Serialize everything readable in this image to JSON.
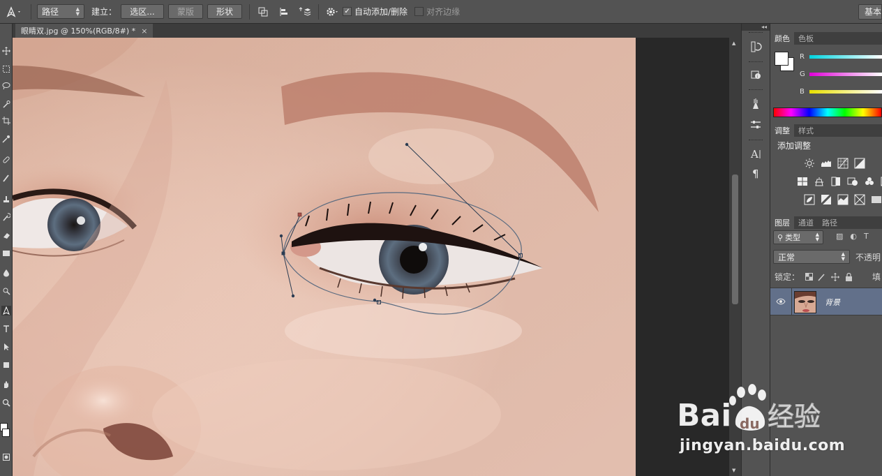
{
  "options_bar": {
    "tool_icon": "pen-icon",
    "mode_select": "路径",
    "make_label": "建立：",
    "selection_button": "选区...",
    "mask_button": "蒙版",
    "shape_button": "形状",
    "path_ops_icon": "path-operations-icon",
    "path_align_icon": "path-alignment-icon",
    "path_arrange_icon": "path-arrangement-icon",
    "settings_icon": "gear-icon",
    "auto_add_delete": {
      "label": "自动添加/删除",
      "checked": true
    },
    "align_edges": {
      "label": "对齐边缘",
      "checked": false
    },
    "workspace_button": "基本"
  },
  "document": {
    "tab_title": "眼睛双.jpg @ 150%(RGB/8#) *",
    "close_glyph": "×"
  },
  "toolbar": {
    "icons": [
      "move-icon",
      "marquee-icon",
      "lasso-icon",
      "quick-select-icon",
      "crop-icon",
      "eyedropper-icon",
      "healing-brush-icon",
      "brush-icon",
      "clone-stamp-icon",
      "history-brush-icon",
      "eraser-icon",
      "gradient-icon",
      "blur-icon",
      "dodge-icon",
      "pen-icon",
      "type-icon",
      "path-select-icon",
      "rectangle-icon",
      "hand-icon",
      "zoom-icon"
    ]
  },
  "icon_strip": {
    "icons": [
      "history-icon",
      "info-icon",
      "brush-presets-icon",
      "properties-icon",
      "character-icon",
      "paragraph-icon"
    ],
    "collapse_glyph": "◂◂"
  },
  "color_panel": {
    "tabs": [
      "颜色",
      "色板"
    ],
    "active_tab": 0,
    "channels": [
      {
        "label": "R",
        "color": "#00d4e0"
      },
      {
        "label": "G",
        "color": "#e000d8"
      },
      {
        "label": "B",
        "color": "#e8e000"
      }
    ]
  },
  "adjustments_panel": {
    "tabs": [
      "调整",
      "样式"
    ],
    "active_tab": 0,
    "title": "添加调整",
    "icons": [
      [
        "brightness-contrast-icon",
        "levels-icon",
        "curves-icon",
        "exposure-icon"
      ],
      [
        "vibrance-icon",
        "hue-saturation-icon",
        "color-balance-icon",
        "black-white-icon",
        "photo-filter-icon",
        "channel-mixer-icon"
      ],
      [
        "invert-icon",
        "posterize-icon",
        "threshold-icon",
        "selective-color-icon",
        "gradient-map-icon"
      ]
    ]
  },
  "layers_panel": {
    "tabs": [
      "图层",
      "通道",
      "路径"
    ],
    "active_tab": 0,
    "filter_select": "类型",
    "blend_mode": "正常",
    "opacity_label": "不透明",
    "lock_label": "锁定：",
    "fill_label": "填",
    "layer": {
      "name": "背景",
      "visible": true
    }
  },
  "watermark": {
    "logo_text": "Bai",
    "logo_text2": "du",
    "logo_cn": "经验",
    "url": "jingyan.baidu.com"
  }
}
